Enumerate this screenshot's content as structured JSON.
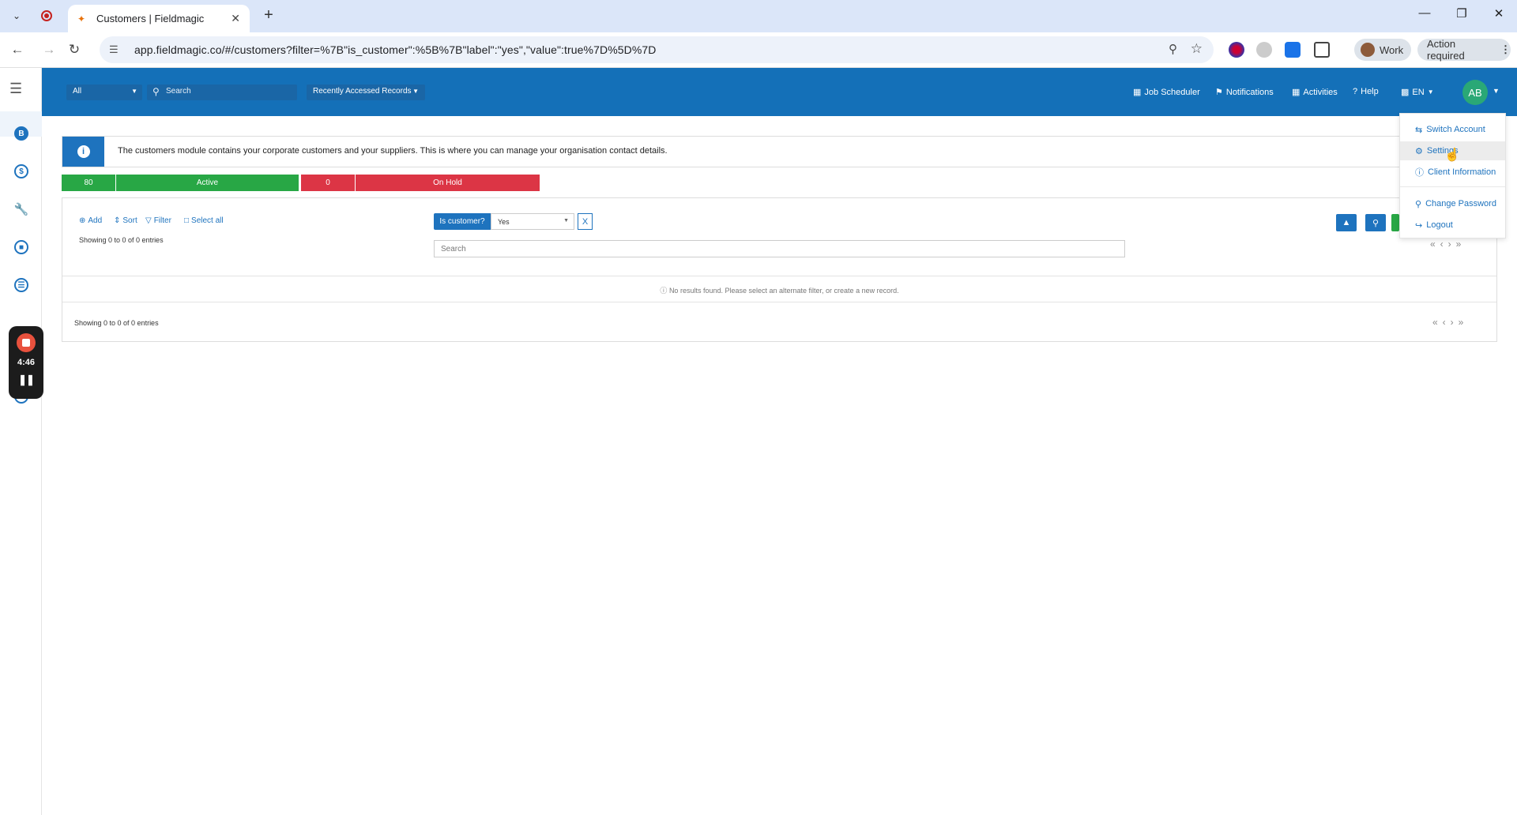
{
  "browser": {
    "tab_title": "Customers | Fieldmagic",
    "url": "app.fieldmagic.co/#/customers?filter=%7B\"is_customer\":%5B%7B\"label\":\"yes\",\"value\":true%7D%5D%7D",
    "profile_label": "Work",
    "action_label": "Action required"
  },
  "recorder": {
    "time": "4:46"
  },
  "appbar": {
    "scope": "All",
    "search_placeholder": "Search",
    "recent": "Recently Accessed Records",
    "nav": {
      "job_scheduler": "Job Scheduler",
      "notifications": "Notifications",
      "activities": "Activities",
      "help": "Help",
      "language": "EN"
    },
    "avatar_initials": "AB"
  },
  "info": {
    "text": "The customers module contains your corporate customers and your suppliers. This is where you can manage your organisation contact details."
  },
  "status": {
    "active_count": "80",
    "active_label": "Active",
    "on_hold_count": "0",
    "on_hold_label": "On Hold",
    "active_color": "#28a745",
    "on_hold_color": "#dc3545"
  },
  "toolbar": {
    "add": "Add",
    "sort": "Sort",
    "filter": "Filter",
    "select_all": "Select all",
    "showing": "Showing 0 to 0 of 0 entries"
  },
  "filter_chip": {
    "label": "Is customer?",
    "value": "Yes",
    "clear": "X"
  },
  "table": {
    "search_placeholder": "Search",
    "no_results": "No results found. Please select an alternate filter, or create a new record.",
    "showing_bottom": "Showing 0 to 0 of 0 entries"
  },
  "user_menu": {
    "switch_account": "Switch Account",
    "settings": "Settings",
    "client_information": "Client Information",
    "change_password": "Change Password",
    "logout": "Logout"
  },
  "colors": {
    "brand_blue": "#1470b8",
    "accent": "#1e73be"
  }
}
